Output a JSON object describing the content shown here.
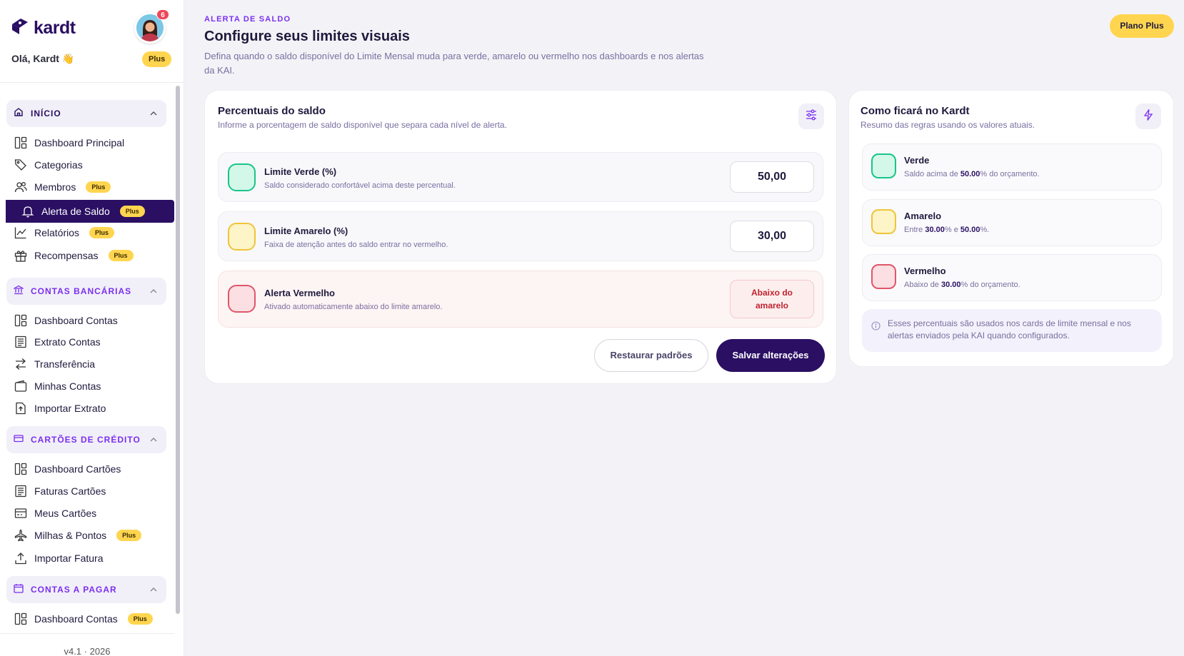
{
  "sidebar": {
    "brand": "kardt",
    "greeting": "Olá, Kardt 👋",
    "notifications": "6",
    "plan_badge": "Plus",
    "sections": {
      "inicio": "INÍCIO",
      "contas_bancarias": "CONTAS BANCÁRIAS",
      "cartoes": "CARTÕES DE CRÉDITO",
      "contas_pagar": "CONTAS A PAGAR"
    },
    "items": {
      "dashboard_principal": "Dashboard Principal",
      "categorias": "Categorias",
      "membros": "Membros",
      "alerta_saldo": "Alerta de Saldo",
      "relatorios": "Relatórios",
      "recompensas": "Recompensas",
      "dashboard_contas": "Dashboard Contas",
      "extrato_contas": "Extrato Contas",
      "transferencia": "Transferência",
      "minhas_contas": "Minhas Contas",
      "importar_extrato": "Importar Extrato",
      "dashboard_cartoes": "Dashboard Cartões",
      "faturas_cartoes": "Faturas Cartões",
      "meus_cartoes": "Meus Cartões",
      "milhas_pontos": "Milhas & Pontos",
      "importar_fatura": "Importar Fatura",
      "dashboard_contas_pagar": "Dashboard Contas"
    },
    "item_badge": "Plus",
    "version": "v4.1 · 2026"
  },
  "header": {
    "eyebrow": "ALERTA DE SALDO",
    "title": "Configure seus limites visuais",
    "description": "Defina quando o saldo disponível do Limite Mensal muda para verde, amarelo ou vermelho nos dashboards e nos alertas da KAI.",
    "plan_button": "Plano Plus"
  },
  "percent_card": {
    "title": "Percentuais do saldo",
    "subtitle": "Informe a porcentagem de saldo disponível que separa cada nível de alerta.",
    "verde": {
      "title": "Limite Verde (%)",
      "subtitle": "Saldo considerado confortável acima deste percentual.",
      "value": "50,00"
    },
    "amarelo": {
      "title": "Limite Amarelo (%)",
      "subtitle": "Faixa de atenção antes do saldo entrar no vermelho.",
      "value": "30,00"
    },
    "vermelho": {
      "title": "Alerta Vermelho",
      "subtitle": "Ativado automaticamente abaixo do limite amarelo.",
      "value": "Abaixo do amarelo"
    },
    "restore_button": "Restaurar padrões",
    "save_button": "Salvar alterações"
  },
  "preview_card": {
    "title": "Como ficará no Kardt",
    "subtitle": "Resumo das regras usando os valores atuais.",
    "verde": {
      "title": "Verde",
      "pre": "Saldo acima de ",
      "v1": "50.00",
      "post": "% do orçamento."
    },
    "amarelo": {
      "title": "Amarelo",
      "pre": "Entre ",
      "v1": "30.00",
      "mid": "% e ",
      "v2": "50.00",
      "post": "%."
    },
    "vermelho": {
      "title": "Vermelho",
      "pre": "Abaixo de ",
      "v1": "30.00",
      "post": "% do orçamento."
    },
    "info": "Esses percentuais são usados nos cards de limite mensal e nos alertas enviados pela KAI quando configurados."
  },
  "colors": {
    "brand": "#2a0f63",
    "accent": "#7b2ff0",
    "plus": "#ffd54f",
    "green": "#19c48a",
    "yellow": "#f0c43a",
    "red": "#e0566a"
  }
}
